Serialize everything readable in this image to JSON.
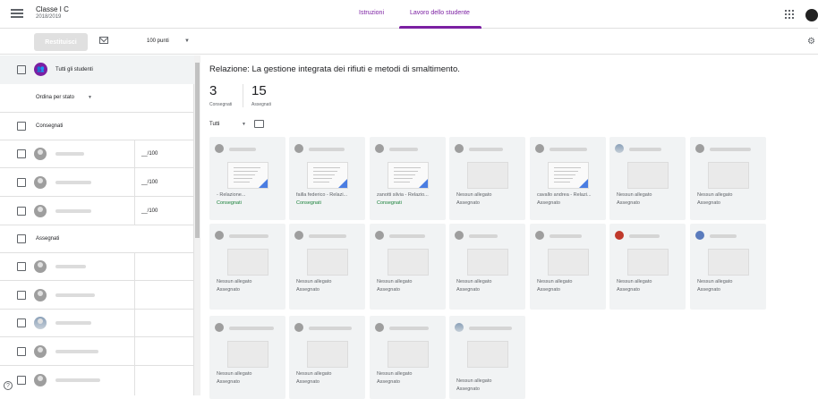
{
  "header": {
    "class_name": "Classe I C",
    "year": "2018/2019",
    "tabs": [
      "Istruzioni",
      "Lavoro dello studente"
    ]
  },
  "toolbar": {
    "return_label": "Restituisci",
    "points": "100 punti"
  },
  "sidebar": {
    "all_students": "Tutti gli studenti",
    "sort": "Ordina per stato",
    "turned_in_header": "Consegnati",
    "assigned_header": "Assegnati",
    "turned_in_grades": [
      "__/100",
      "__/100",
      "__/100"
    ]
  },
  "main": {
    "title": "Relazione: La gestione integrata dei rifiuti e metodi di smaltimento.",
    "count_turned_in": "3",
    "label_turned_in": "Consegnati",
    "count_assigned": "15",
    "label_assigned": "Assegnati",
    "filter": "Tutti",
    "cards": [
      {
        "label": "- Relazione...",
        "status": "Consegnati"
      },
      {
        "label": "failla federico - Relazi...",
        "status": "Consegnati"
      },
      {
        "label": "zanotti silvia - Relazio...",
        "status": "Consegnati"
      },
      {
        "label": "Nessun allegato",
        "status": "Assegnato"
      },
      {
        "label": "cavallo andrea - Relazi...",
        "status": "Assegnato"
      },
      {
        "label": "Nessun allegato",
        "status": "Assegnato"
      },
      {
        "label": "Nessun allegato",
        "status": "Assegnato"
      },
      {
        "label": "Nessun allegato",
        "status": "Assegnato"
      },
      {
        "label": "Nessun allegato",
        "status": "Assegnato"
      },
      {
        "label": "Nessun allegato",
        "status": "Assegnato"
      },
      {
        "label": "Nessun allegato",
        "status": "Assegnato"
      },
      {
        "label": "Nessun allegato",
        "status": "Assegnato"
      },
      {
        "label": "Nessun allegato",
        "status": "Assegnato"
      },
      {
        "label": "Nessun allegato",
        "status": "Assegnato"
      },
      {
        "label": "Nessun allegato",
        "status": "Assegnato"
      },
      {
        "label": "Nessun allegato",
        "status": "Assegnato"
      },
      {
        "label": "Nessun allegato",
        "status": "Assegnato"
      },
      {
        "label": "Nessun allegato",
        "status": "Assegnato"
      }
    ]
  }
}
